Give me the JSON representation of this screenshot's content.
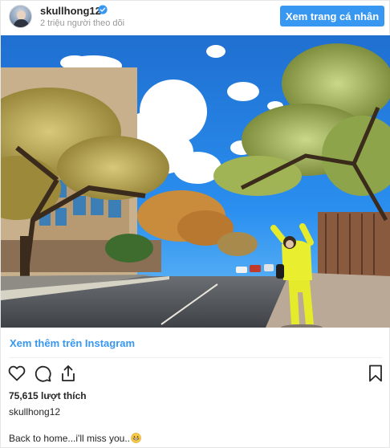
{
  "header": {
    "username": "skullhong12",
    "followers": "2 triệu người theo dõi",
    "view_profile_label": "Xem trang cá nhân",
    "verified_icon": "verified-badge-icon",
    "verified_color": "#3897f0"
  },
  "photo": {
    "alt_icon": "instagram-photo"
  },
  "footer": {
    "more_link": "Xem thêm trên Instagram",
    "actions": {
      "like_icon": "heart-icon",
      "comment_icon": "comment-icon",
      "share_icon": "share-icon",
      "save_icon": "bookmark-icon"
    },
    "likes": "75,615 lượt thích",
    "caption_user": "skullhong12",
    "caption_text": "Back to home...i'll miss you..",
    "caption_emoji": "grinning-face-emoji"
  },
  "colors": {
    "accent": "#3897f0",
    "text": "#262626",
    "muted": "#999999"
  }
}
